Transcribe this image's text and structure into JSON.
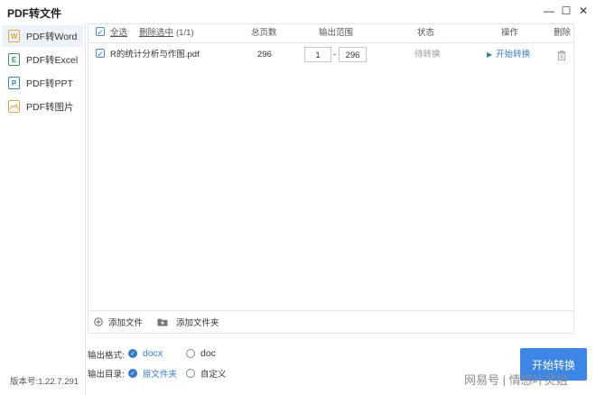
{
  "window": {
    "title": "PDF转文件",
    "minimize": "—",
    "maximize": "☐",
    "close": "✕"
  },
  "sidebar": {
    "items": [
      {
        "label": "PDF转Word",
        "icon": "word-icon",
        "letter": "W",
        "color": "#e8a33a"
      },
      {
        "label": "PDF转Excel",
        "icon": "excel-icon",
        "letter": "E",
        "color": "#2e9b5a"
      },
      {
        "label": "PDF转PPT",
        "icon": "ppt-icon",
        "letter": "P",
        "color": "#2f7bd6"
      },
      {
        "label": "PDF转图片",
        "icon": "image-icon",
        "letter": "",
        "color": "#e8a33a"
      }
    ],
    "version": "版本号:1.22.7.291"
  },
  "table": {
    "select_all": "全选",
    "delete_selected": "删除选中",
    "count": "(1/1)",
    "col_pages": "总页数",
    "col_range": "输出范围",
    "col_status": "状态",
    "col_action": "操作",
    "col_delete": "删除",
    "rows": [
      {
        "filename": "R的统计分析与作图.pdf",
        "pages": "296",
        "range_from": "1",
        "range_sep": "-",
        "range_to": "296",
        "status": "待转换",
        "action": "开始转换"
      }
    ],
    "add_file": "添加文件",
    "add_folder": "添加文件夹"
  },
  "options": {
    "format_label": "输出格式:",
    "format_docx": "docx",
    "format_doc": "doc",
    "dir_label": "输出目录:",
    "dir_source": "原文件夹",
    "dir_custom": "自定义"
  },
  "start_button": "开始转换",
  "watermark": "网易号 | 情感叶灵姐",
  "colors": {
    "accent": "#2f7bd6",
    "button": "#3b86e6"
  }
}
